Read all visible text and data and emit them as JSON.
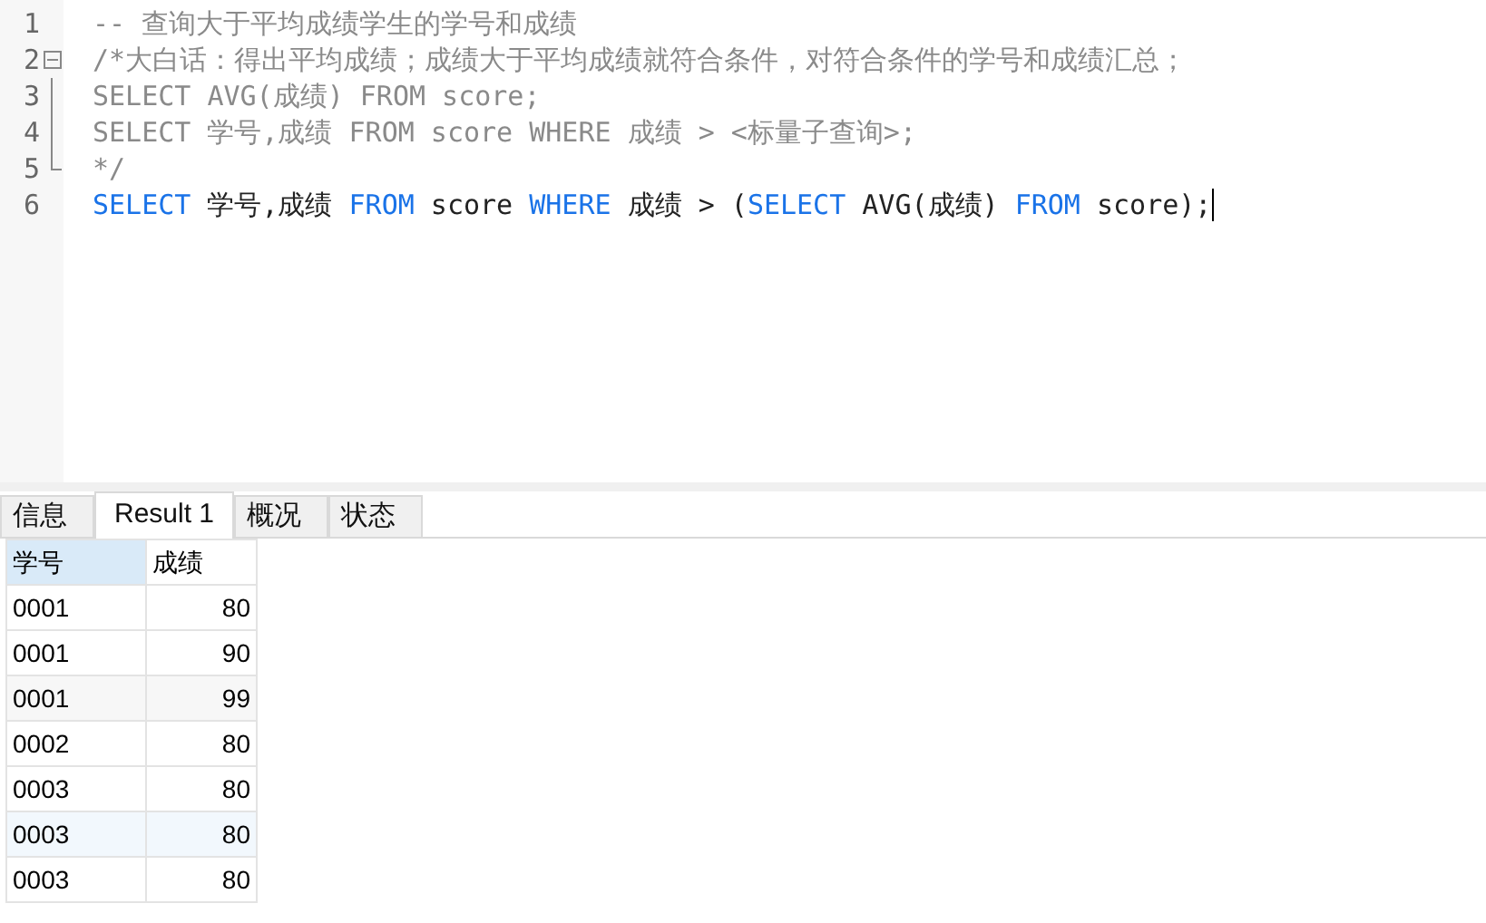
{
  "editor": {
    "lines": [
      {
        "number": "1",
        "collapsible": false,
        "in_fold": false,
        "caret": false,
        "tokens": [
          {
            "text": "-- 查询大于平均成绩学生的学号和成绩",
            "kind": "comment"
          }
        ]
      },
      {
        "number": "2",
        "collapsible": true,
        "in_fold": false,
        "caret": false,
        "tokens": [
          {
            "text": "/*大白话：得出平均成绩；成绩大于平均成绩就符合条件，对符合条件的学号和成绩汇总；",
            "kind": "comment"
          }
        ]
      },
      {
        "number": "3",
        "collapsible": false,
        "in_fold": true,
        "caret": false,
        "tokens": [
          {
            "text": "SELECT AVG(成绩) FROM score;",
            "kind": "comment"
          }
        ]
      },
      {
        "number": "4",
        "collapsible": false,
        "in_fold": true,
        "caret": false,
        "tokens": [
          {
            "text": "SELECT 学号,成绩 FROM score WHERE 成绩 > <标量子查询>;",
            "kind": "comment"
          }
        ]
      },
      {
        "number": "5",
        "collapsible": false,
        "in_fold": true,
        "caret": false,
        "tokens": [
          {
            "text": "*/",
            "kind": "comment"
          }
        ]
      },
      {
        "number": "6",
        "collapsible": false,
        "in_fold": false,
        "caret": true,
        "tokens": [
          {
            "text": "SELECT",
            "kind": "keyword"
          },
          {
            "text": " 学号,成绩 ",
            "kind": "plain"
          },
          {
            "text": "FROM",
            "kind": "keyword"
          },
          {
            "text": " score ",
            "kind": "plain"
          },
          {
            "text": "WHERE",
            "kind": "keyword"
          },
          {
            "text": " 成绩 > (",
            "kind": "plain"
          },
          {
            "text": "SELECT",
            "kind": "keyword"
          },
          {
            "text": " AVG(成绩) ",
            "kind": "plain"
          },
          {
            "text": "FROM",
            "kind": "keyword"
          },
          {
            "text": " score);",
            "kind": "plain"
          }
        ]
      }
    ]
  },
  "tabs": [
    {
      "label": "信息",
      "selected": false
    },
    {
      "label": "Result 1",
      "selected": true
    },
    {
      "label": "概况",
      "selected": false
    },
    {
      "label": "状态",
      "selected": false
    }
  ],
  "table": {
    "columns": [
      {
        "label": "学号",
        "selected": true
      },
      {
        "label": "成绩",
        "selected": false
      }
    ],
    "rows": [
      {
        "kind": "plain",
        "cells": [
          "0001",
          "80"
        ]
      },
      {
        "kind": "plain",
        "cells": [
          "0001",
          "90"
        ]
      },
      {
        "kind": "striped",
        "cells": [
          "0001",
          "99"
        ]
      },
      {
        "kind": "plain",
        "cells": [
          "0002",
          "80"
        ]
      },
      {
        "kind": "plain",
        "cells": [
          "0003",
          "80"
        ]
      },
      {
        "kind": "hovered",
        "cells": [
          "0003",
          "80"
        ]
      },
      {
        "kind": "plain",
        "cells": [
          "0003",
          "80"
        ]
      }
    ]
  }
}
